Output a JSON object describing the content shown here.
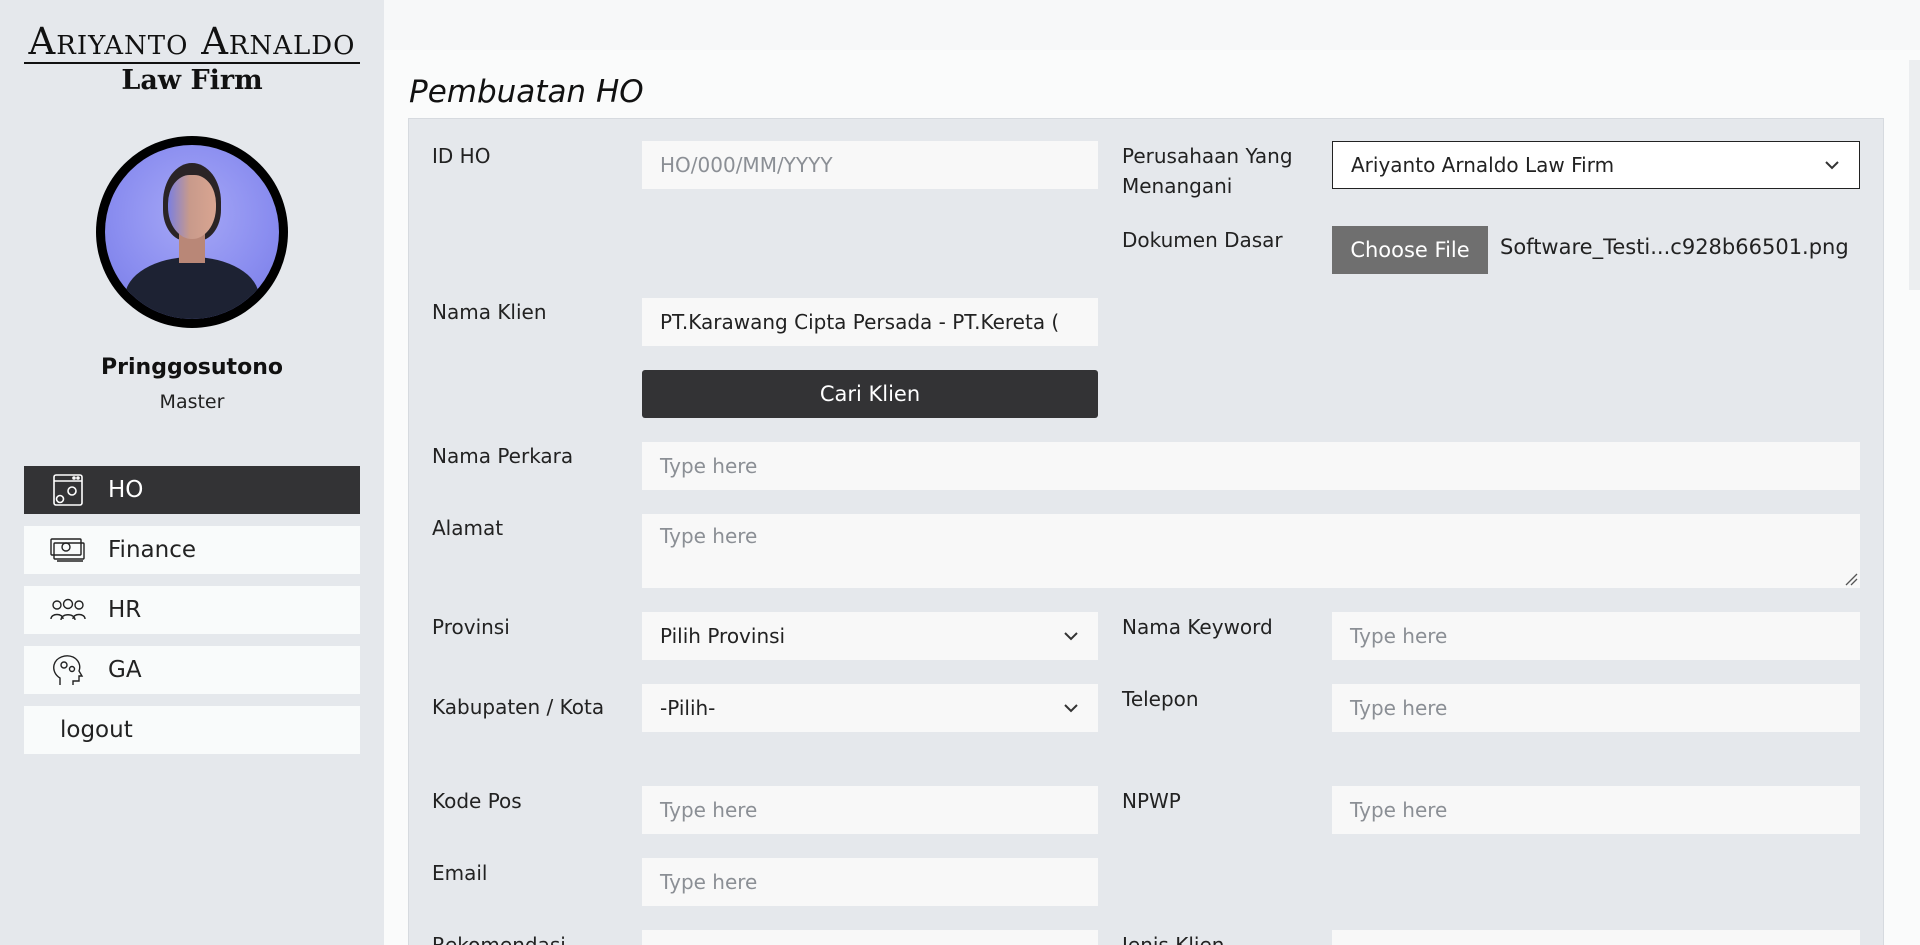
{
  "sidebar": {
    "logo": {
      "line1": "Ariyanto Arnaldo",
      "line2": "Law Firm"
    },
    "user": {
      "name": "Pringgosutono",
      "role": "Master"
    },
    "menu": [
      {
        "label": "HO",
        "icon": "settings-screen-icon",
        "active": true
      },
      {
        "label": "Finance",
        "icon": "money-icon",
        "active": false
      },
      {
        "label": "HR",
        "icon": "people-icon",
        "active": false
      },
      {
        "label": "GA",
        "icon": "head-gears-icon",
        "active": false
      },
      {
        "label": "logout",
        "icon": "",
        "active": false
      }
    ]
  },
  "page": {
    "title": "Pembuatan HO"
  },
  "form": {
    "id_ho": {
      "label": "ID HO",
      "placeholder": "HO/000/MM/YYYY"
    },
    "perusahaan": {
      "label_line1": "Perusahaan Yang",
      "label_line2": "Menangani",
      "value": "Ariyanto Arnaldo Law Firm"
    },
    "dokumen_dasar": {
      "label": "Dokumen Dasar",
      "button": "Choose File",
      "file_name": "Software_Testi...c928b66501.png"
    },
    "nama_klien": {
      "label": "Nama Klien",
      "value": "PT.Karawang Cipta Persada - PT.Kereta ("
    },
    "cari_klien": {
      "label": "Cari Klien"
    },
    "nama_perkara": {
      "label": "Nama Perkara",
      "placeholder": "Type here"
    },
    "alamat": {
      "label": "Alamat",
      "placeholder": "Type here"
    },
    "provinsi": {
      "label": "Provinsi",
      "value": "Pilih Provinsi"
    },
    "nama_keyword": {
      "label": "Nama Keyword",
      "placeholder": "Type here"
    },
    "kabupaten": {
      "label": "Kabupaten / Kota",
      "value": "-Pilih-"
    },
    "telepon": {
      "label": "Telepon",
      "placeholder": "Type here"
    },
    "kode_pos": {
      "label": "Kode Pos",
      "placeholder": "Type here"
    },
    "npwp": {
      "label": "NPWP",
      "placeholder": "Type here"
    },
    "email": {
      "label": "Email",
      "placeholder": "Type here"
    },
    "rekomendasi": {
      "label": "Rekomendasi"
    },
    "jenis_klien": {
      "label": "Jenis Klien"
    }
  }
}
